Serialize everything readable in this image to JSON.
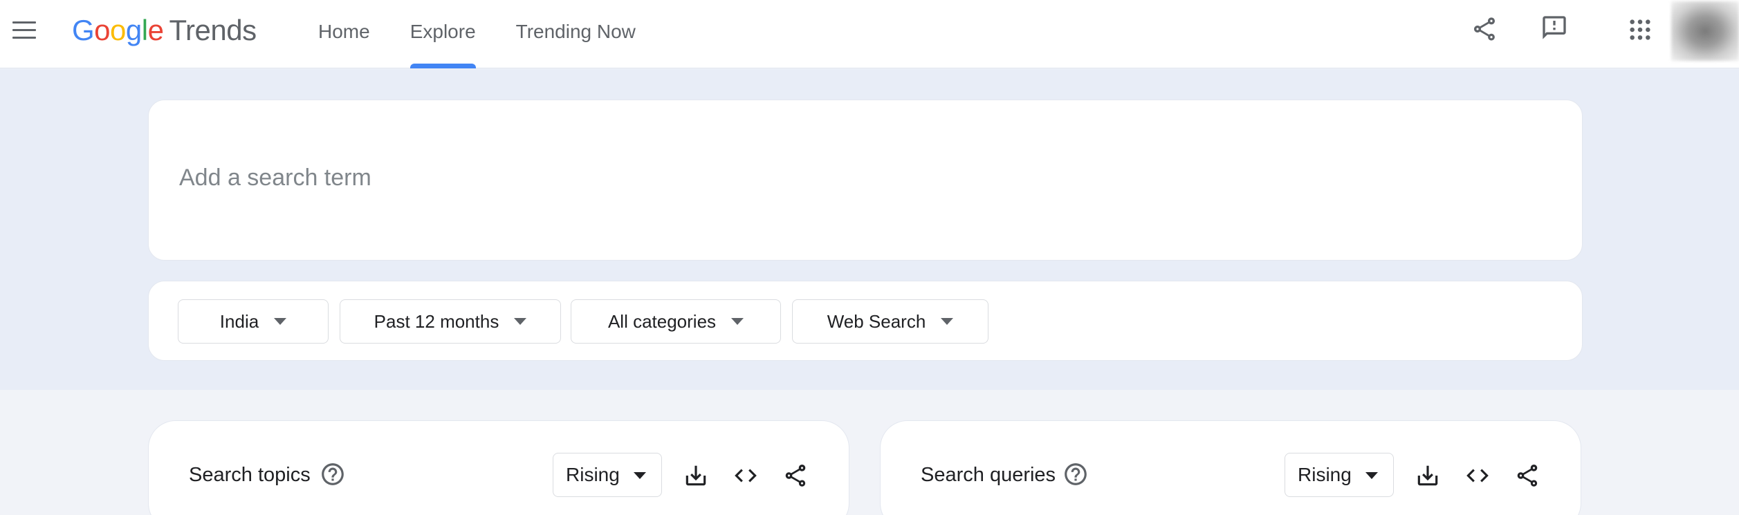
{
  "app": {
    "logo_google": [
      "G",
      "o",
      "o",
      "g",
      "l",
      "e"
    ],
    "logo_product": "Trends"
  },
  "nav": {
    "tabs": [
      {
        "label": "Home",
        "active": false
      },
      {
        "label": "Explore",
        "active": true
      },
      {
        "label": "Trending Now",
        "active": false
      }
    ]
  },
  "header_icons": [
    "menu-icon",
    "share-icon",
    "feedback-icon",
    "apps-icon",
    "avatar"
  ],
  "search": {
    "placeholder": "Add a search term",
    "value": ""
  },
  "filters": {
    "region": "India",
    "time_range": "Past 12 months",
    "category": "All categories",
    "property": "Web Search"
  },
  "panels": {
    "topics": {
      "title": "Search topics",
      "selector": "Rising"
    },
    "queries": {
      "title": "Search queries",
      "selector": "Rising"
    }
  },
  "colors": {
    "accent": "#4285f4",
    "google_red": "#ea4335",
    "google_yellow": "#fbbc05",
    "google_green": "#34a853",
    "band": "#e8edf7"
  }
}
